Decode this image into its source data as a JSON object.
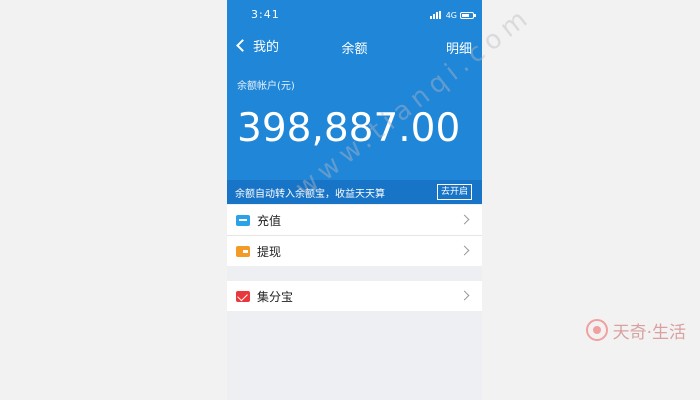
{
  "status_bar": {
    "time": "3:41",
    "network": "4G"
  },
  "nav": {
    "back_label": "我的",
    "title": "余额",
    "detail_label": "明细"
  },
  "balance": {
    "label": "余额帐户(元)",
    "amount": "398,887.00"
  },
  "promo": {
    "text": "余额自动转入余额宝，收益天天算",
    "button_label": "去开启"
  },
  "menu": {
    "recharge_label": "充值",
    "withdraw_label": "提现",
    "jifenbao_label": "集分宝"
  },
  "watermark": {
    "text": "www.tianqi.com"
  },
  "logo": {
    "text": "天奇·生活"
  },
  "colors": {
    "primary": "#1f86d8",
    "promo_bar": "#1874c6",
    "recharge_icon": "#2aa1e8",
    "withdraw_icon": "#f39a27",
    "jifenbao_icon": "#e8383d"
  }
}
